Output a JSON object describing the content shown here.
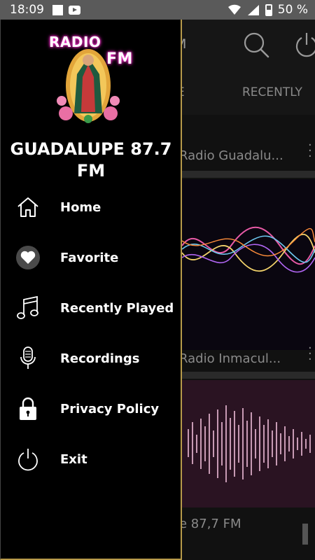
{
  "status_bar": {
    "time": "18:09",
    "battery": "50 %",
    "icons": [
      "notification-square-icon",
      "youtube-icon",
      "wifi-icon",
      "signal-icon",
      "battery-icon"
    ]
  },
  "drawer": {
    "logo": {
      "line1": "RADIO",
      "line2": "FM"
    },
    "title": "GUADALUPE 87.7 FM",
    "items": [
      {
        "label": "Home",
        "icon": "home-icon"
      },
      {
        "label": "Favorite",
        "icon": "heart-icon"
      },
      {
        "label": "Recently Played",
        "icon": "music-note-icon"
      },
      {
        "label": "Recordings",
        "icon": "microphone-icon"
      },
      {
        "label": "Privacy Policy",
        "icon": "lock-icon"
      },
      {
        "label": "Exit",
        "icon": "power-icon"
      }
    ]
  },
  "background": {
    "toolbar_title_fragment": "M",
    "tabs": [
      "E",
      "RECENTLY"
    ],
    "cards": [
      {
        "title": "Radio Guadalu..."
      },
      {
        "title": "Radio Inmacul..."
      }
    ],
    "bottom_title": "e 87,7 FM"
  },
  "colors": {
    "drawer_border": "#b79a4a",
    "logo_glow": "#ff2bd1",
    "status_bar": "#5a5a5a"
  }
}
